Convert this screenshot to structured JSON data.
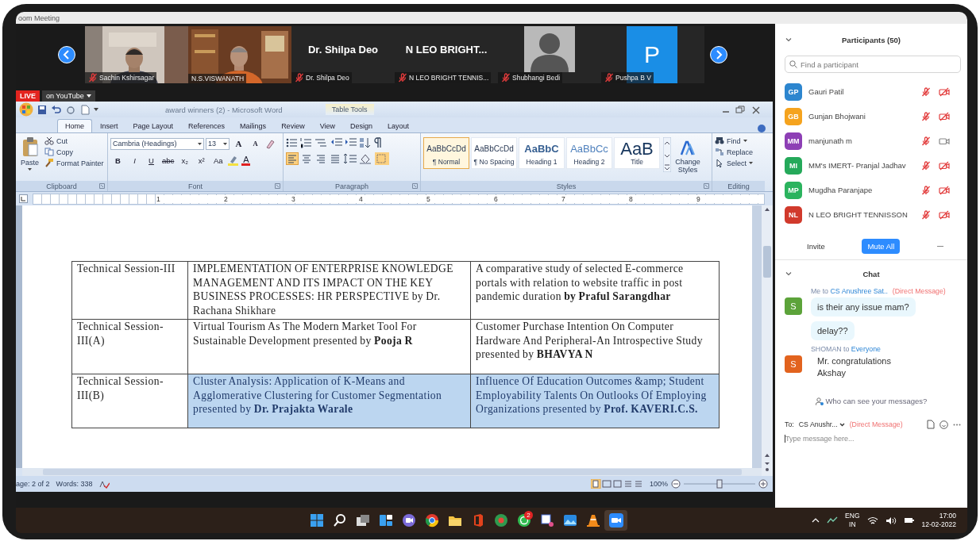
{
  "window": {
    "title": "oom Meeting"
  },
  "video_strip": {
    "tiles": [
      {
        "kind": "video",
        "name": "Sachin Kshirsagar",
        "muted": true
      },
      {
        "kind": "video",
        "name": "N.S.VISWANATH",
        "muted": false
      },
      {
        "kind": "name",
        "display_name": "Dr. Shilpa Deo",
        "name": "Dr. Shilpa Deo",
        "muted": true
      },
      {
        "kind": "name",
        "display_name": "N LEO BRIGHT...",
        "name": "N LEO BRIGHT TENNIS...",
        "muted": true
      },
      {
        "kind": "avatar",
        "name": "Shubhangi Bedi",
        "muted": true
      },
      {
        "kind": "letter",
        "letter": "P",
        "name": "Pushpa B V",
        "muted": true
      }
    ]
  },
  "stream": {
    "badge": "LIVE",
    "destination": "on YouTube"
  },
  "word": {
    "title": "award winners (2) - Microsoft Word",
    "context_tab": "Table Tools",
    "tabs": [
      {
        "label": "Home",
        "selected": true
      },
      {
        "label": "Insert",
        "selected": false
      },
      {
        "label": "Page Layout",
        "selected": false
      },
      {
        "label": "References",
        "selected": false
      },
      {
        "label": "Mailings",
        "selected": false
      },
      {
        "label": "Review",
        "selected": false
      },
      {
        "label": "View",
        "selected": false
      },
      {
        "label": "Design",
        "selected": false
      },
      {
        "label": "Layout",
        "selected": false
      }
    ],
    "clipboard": {
      "label": "Clipboard",
      "paste": "Paste",
      "cut": "Cut",
      "copy": "Copy",
      "format_painter": "Format Painter"
    },
    "font": {
      "label": "Font",
      "name": "Cambria (Headings)",
      "size": "13",
      "size_buttons": [
        "A",
        "A"
      ],
      "color_button": "A",
      "format_buttons": [
        {
          "kind": "bold",
          "label": "B"
        },
        {
          "kind": "italic",
          "label": "I"
        },
        {
          "kind": "underline",
          "label": "U"
        },
        {
          "kind": "strike",
          "label": "abc"
        },
        {
          "kind": "sub",
          "label": "x₂"
        },
        {
          "kind": "sup",
          "label": "x²"
        },
        {
          "kind": "case",
          "label": "Aa"
        }
      ]
    },
    "paragraph": {
      "label": "Paragraph",
      "alignments": [
        {
          "kind": "left",
          "selected": true
        },
        {
          "kind": "center",
          "selected": false
        },
        {
          "kind": "right",
          "selected": false
        },
        {
          "kind": "justify",
          "selected": false
        }
      ]
    },
    "styles": {
      "label": "Styles",
      "change_styles": "Change Styles",
      "items": [
        {
          "kind": "body",
          "preview": "AaBbCcDd",
          "label": "¶ Normal",
          "selected": true
        },
        {
          "kind": "body",
          "preview": "AaBbCcDd",
          "label": "¶ No Spacing",
          "selected": false
        },
        {
          "kind": "heading1",
          "preview": "AaBbC",
          "label": "Heading 1",
          "selected": false
        },
        {
          "kind": "heading2",
          "preview": "AaBbCc",
          "label": "Heading 2",
          "selected": false
        },
        {
          "kind": "title",
          "preview": "AaB",
          "label": "Title",
          "selected": false
        }
      ]
    },
    "editing": {
      "label": "Editing",
      "find": "Find",
      "replace": "Replace",
      "select": "Select"
    },
    "ruler": [
      "1",
      "2",
      "3",
      "4",
      "5",
      "6",
      "7",
      "8",
      "9"
    ],
    "table": {
      "rows": [
        {
          "cells": [
            {
              "text": "Technical Session-III",
              "selected": false
            },
            {
              "text": "IMPLEMENTATION OF ENTERPRISE KNOWLEDGE MANAGEMENT AND ITS IMPACT ON THE KEY BUSINESS PROCESSES: HR PERSPECTIVE by Dr. Rachana Shikhare",
              "selected": false
            },
            {
              "text": "A comparative study of selected E-commerce portals with relation to website traffic in post pandemic duration **by Praful Sarangdhar**",
              "selected": false
            }
          ]
        },
        {
          "cells": [
            {
              "text": "Technical Session-III(A)",
              "selected": false
            },
            {
              "text": "Virtual Tourism As The Modern Market Tool For Sustainable Development presented by **Pooja R**",
              "selected": false
            },
            {
              "text": "Customer Purchase Intention On Computer Hardware And Peripheral-An Introspective Study presented by **BHAVYA N**",
              "selected": false
            }
          ]
        },
        {
          "cells": [
            {
              "text": "Technical Session-III(B)",
              "selected": false
            },
            {
              "text": "Cluster Analysis: Application of K-Means and Agglomerative Clustering for Customer Segmentation presented by **Dr. Prajakta Warale**",
              "selected": true
            },
            {
              "text": "Influence Of Education Outcomes &amp; Student Employability Talents On Outlooks Of Employing Organizations presented by **Prof. KAVERI.C.S.**",
              "selected": true
            }
          ]
        }
      ]
    },
    "status_bar": {
      "page": "age: 2 of 2",
      "words": "Words: 338",
      "zoom": "100%"
    }
  },
  "participants": {
    "title": "Participants (50)",
    "placeholder": "Find a participant",
    "items": [
      {
        "initials": "GP",
        "name": "Gauri Patil",
        "color": "#2d86cf",
        "muted": true,
        "video_off": true
      },
      {
        "initials": "GB",
        "name": "Gunjan Bhojwani",
        "color": "#f5a31e",
        "muted": true,
        "video_off": true
      },
      {
        "initials": "MM",
        "name": "manjunath m",
        "color": "#8d3fb5",
        "muted": true,
        "video_off": false
      },
      {
        "initials": "MI",
        "name": "MM's IMERT- Pranjal Jadhav",
        "color": "#25a95a",
        "muted": true,
        "video_off": true
      },
      {
        "initials": "MP",
        "name": "Mugdha Paranjape",
        "color": "#2bb35e",
        "muted": true,
        "video_off": true
      },
      {
        "initials": "NL",
        "name": "N LEO BRIGHT TENNISSON",
        "color": "#d13a2c",
        "muted": true,
        "video_off": true
      }
    ],
    "buttons": [
      "Invite",
      "Mute All"
    ]
  },
  "chat": {
    "title": "Chat",
    "messages": [
      {
        "sender": "Me",
        "connector": "to",
        "recipient": "CS Anushree Sat..",
        "note": "(Direct Message)",
        "avatar": "S",
        "color": "#5ca33a",
        "highlighted": true,
        "texts": [
          "is their any issue mam?",
          "delay??"
        ]
      },
      {
        "sender": "SHOMAN",
        "connector": "to",
        "recipient": "Everyone",
        "avatar": "S",
        "color": "#e2631e",
        "highlighted": false,
        "texts": [
          "Mr. congratulations Akshay"
        ]
      }
    ],
    "privacy_link": "Who can see your messages?",
    "to_label": "To:",
    "recipient": "CS Anushr...",
    "note": "(Direct Message)",
    "placeholder": "Type message here..."
  },
  "taskbar": {
    "badge": "2",
    "language": "ENG",
    "region": "IN",
    "time": "17:00",
    "date": "12-02-2022"
  }
}
